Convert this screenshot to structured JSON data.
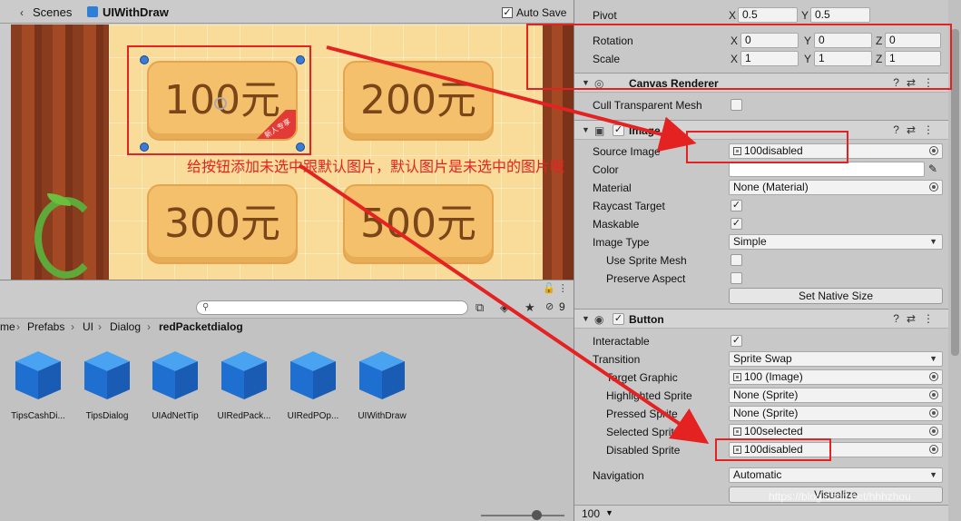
{
  "scene": {
    "tab_scenes": "Scenes",
    "tab_prefab": "UIWithDraw",
    "auto_save_label": "Auto Save",
    "buttons": [
      {
        "label": "100元",
        "tag": "新人专享"
      },
      {
        "label": "200元"
      },
      {
        "label": "300元"
      },
      {
        "label": "500元"
      }
    ]
  },
  "annotation": {
    "text": "给按钮添加未选中跟默认图片，默认图片是未选中的图片哦",
    "color": "#e52222"
  },
  "project": {
    "search_placeholder": "",
    "visible_count": "9",
    "breadcrumb": [
      "me",
      "Prefabs",
      "UI",
      "Dialog",
      "redPacketdialog"
    ],
    "assets": [
      "TipsCashDi...",
      "TipsDialog",
      "UIAdNetTip",
      "UIRedPack...",
      "UIRedPOp...",
      "UIWithDraw"
    ]
  },
  "inspector": {
    "pivot": {
      "label": "Pivot",
      "x": "0.5",
      "y": "0.5"
    },
    "rotation": {
      "label": "Rotation",
      "x": "0",
      "y": "0",
      "z": "0"
    },
    "scale": {
      "label": "Scale",
      "x": "1",
      "y": "1",
      "z": "1"
    },
    "canvas_renderer": {
      "title": "Canvas Renderer",
      "cull_label": "Cull Transparent Mesh"
    },
    "image": {
      "title": "Image",
      "source_image_label": "Source Image",
      "source_image_value": "100disabled",
      "color_label": "Color",
      "material_label": "Material",
      "material_value": "None (Material)",
      "raycast_label": "Raycast Target",
      "maskable_label": "Maskable",
      "image_type_label": "Image Type",
      "image_type_value": "Simple",
      "use_sprite_mesh_label": "Use Sprite Mesh",
      "preserve_aspect_label": "Preserve Aspect",
      "set_native_size_label": "Set Native Size"
    },
    "button": {
      "title": "Button",
      "interactable_label": "Interactable",
      "transition_label": "Transition",
      "transition_value": "Sprite Swap",
      "target_graphic_label": "Target Graphic",
      "target_graphic_value": "100 (Image)",
      "highlighted_label": "Highlighted Sprite",
      "highlighted_value": "None (Sprite)",
      "pressed_label": "Pressed Sprite",
      "pressed_value": "None (Sprite)",
      "selected_label": "Selected Sprite",
      "selected_value": "100selected",
      "disabled_label": "Disabled Sprite",
      "disabled_value": "100disabled",
      "navigation_label": "Navigation",
      "navigation_value": "Automatic",
      "visualize_label": "Visualize"
    },
    "zoom_value": "100",
    "watermark": "https://blog.csdn.net/hhhzhou"
  }
}
